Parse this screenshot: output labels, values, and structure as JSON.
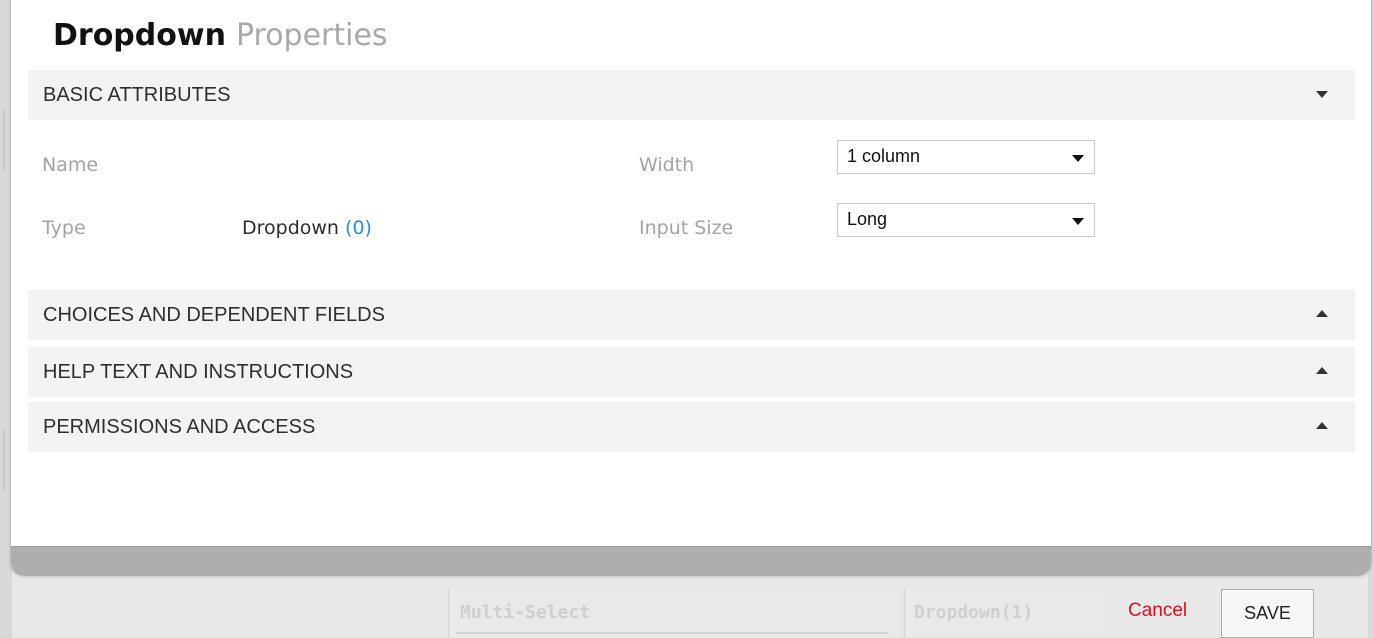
{
  "dialog": {
    "title_primary": "Dropdown",
    "title_secondary": "Properties"
  },
  "sections": {
    "basic": {
      "label": "BASIC ATTRIBUTES",
      "expanded": true
    },
    "choices": {
      "label": "CHOICES AND DEPENDENT FIELDS",
      "expanded": false
    },
    "help": {
      "label": "HELP TEXT AND INSTRUCTIONS",
      "expanded": false
    },
    "permissions": {
      "label": "PERMISSIONS AND ACCESS",
      "expanded": false
    }
  },
  "basic_attributes": {
    "name_label": "Name",
    "name_value": "",
    "type_label": "Type",
    "type_value": "Dropdown",
    "type_count": "(0)",
    "width_label": "Width",
    "width_value": "1 column",
    "input_size_label": "Input Size",
    "input_size_value": "Long"
  },
  "footer": {
    "cancel_label": "Cancel",
    "save_label": "SAVE"
  },
  "background_page": {
    "tile_left_label": "Multi-Select",
    "tile_right_label": "Dropdown(1)"
  },
  "colors": {
    "cancel": "#d2141e",
    "count_link": "#2e8ed8",
    "section_header_bg": "#f3f3f3",
    "label_gray": "#a3a3a3"
  },
  "icons": {
    "section_expanded": "caret-down-icon",
    "section_collapsed": "caret-up-icon",
    "select_arrow": "caret-down-icon"
  }
}
